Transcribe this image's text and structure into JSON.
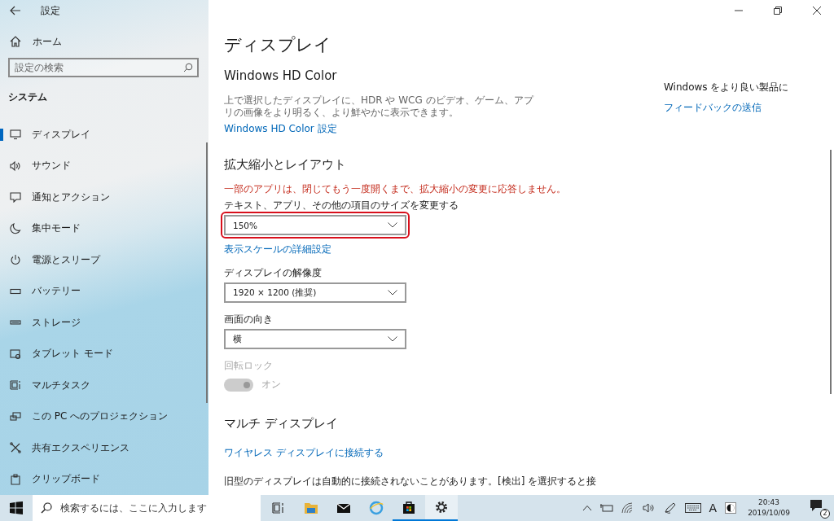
{
  "window": {
    "title": "設定"
  },
  "sidebar": {
    "home": "ホーム",
    "search": {
      "placeholder": "設定の検索"
    },
    "section": "システム",
    "items": [
      {
        "kind": "display",
        "label": "ディスプレイ",
        "selected": true
      },
      {
        "kind": "sound",
        "label": "サウンド",
        "selected": false
      },
      {
        "kind": "notify",
        "label": "通知とアクション",
        "selected": false
      },
      {
        "kind": "moon",
        "label": "集中モード",
        "selected": false
      },
      {
        "kind": "power",
        "label": "電源とスリープ",
        "selected": false
      },
      {
        "kind": "battery",
        "label": "バッテリー",
        "selected": false
      },
      {
        "kind": "storage",
        "label": "ストレージ",
        "selected": false
      },
      {
        "kind": "tablet",
        "label": "タブレット モード",
        "selected": false
      },
      {
        "kind": "multitask",
        "label": "マルチタスク",
        "selected": false
      },
      {
        "kind": "project",
        "label": "この PC へのプロジェクション",
        "selected": false
      },
      {
        "kind": "share",
        "label": "共有エクスペリエンス",
        "selected": false
      },
      {
        "kind": "clipboard",
        "label": "クリップボード",
        "selected": false
      }
    ]
  },
  "page": {
    "title": "ディスプレイ",
    "hd_color": {
      "heading": "Windows HD Color",
      "description": "上で選択したディスプレイに、HDR や WCG のビデオ、ゲーム、アプリの画像をより明るく、より鮮やかに表示できます。",
      "link": "Windows HD Color 設定"
    },
    "scale_layout": {
      "heading": "拡大縮小とレイアウト",
      "warning": "一部のアプリは、閉じてもう一度開くまで、拡大縮小の変更に応答しません。",
      "fields": [
        {
          "kind": "dropdown",
          "label": "テキスト、アプリ、その他の項目のサイズを変更する",
          "value": "150%",
          "highlighted": true,
          "link": "表示スケールの詳細設定"
        },
        {
          "kind": "dropdown",
          "label": "ディスプレイの解像度",
          "value": "1920 × 1200 (推奨)",
          "highlighted": false
        },
        {
          "kind": "dropdown",
          "label": "画面の向き",
          "value": "横",
          "highlighted": false
        },
        {
          "kind": "toggle",
          "label": "回転ロック",
          "value": "オン",
          "on": true,
          "disabled": true
        }
      ]
    },
    "multi_display": {
      "heading": "マルチ ディスプレイ",
      "link": "ワイヤレス ディスプレイに接続する",
      "description": "旧型のディスプレイは自動的に接続されないことがあります。[検出] を選択すると接"
    }
  },
  "side_panel": {
    "text": "Windows をより良い製品に",
    "link": "フィードバックの送信"
  },
  "taskbar": {
    "search": {
      "placeholder": "検索するには、ここに入力します"
    },
    "apps": [
      {
        "kind": "taskview",
        "running": false,
        "selected": false
      },
      {
        "kind": "folder",
        "running": false,
        "selected": false
      },
      {
        "kind": "mail",
        "running": false,
        "selected": false
      },
      {
        "kind": "browser",
        "running": false,
        "selected": false
      },
      {
        "kind": "store",
        "running": true,
        "selected": false
      },
      {
        "kind": "settings",
        "running": true,
        "selected": true
      }
    ],
    "ime": "A",
    "time": "20:43",
    "date": "2019/10/09",
    "notifications": "2"
  }
}
